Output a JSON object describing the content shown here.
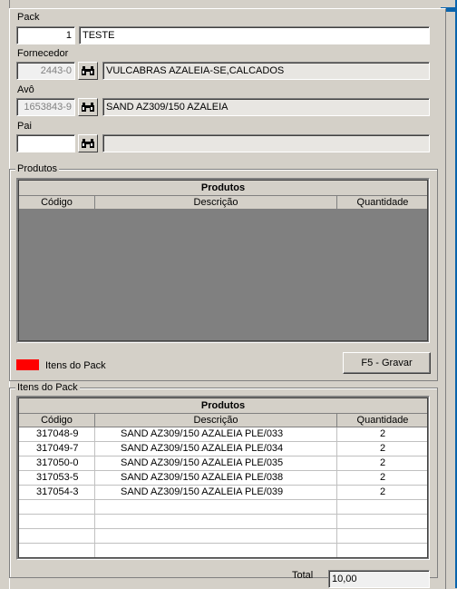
{
  "pack": {
    "label": "Pack",
    "number": "1",
    "name": "TESTE"
  },
  "fornecedor": {
    "label": "Fornecedor",
    "code": "2443-0",
    "name": "VULCABRAS AZALEIA-SE,CALCADOS"
  },
  "avo": {
    "label": "Avô",
    "code": "1653843-9",
    "name": "SAND AZ309/150 AZALEIA"
  },
  "pai": {
    "label": "Pai",
    "code": "",
    "name": ""
  },
  "produtos": {
    "group_title": "Produtos",
    "grid_title": "Produtos",
    "columns": [
      "Código",
      "Descrição",
      "Quantidade"
    ],
    "rows": []
  },
  "legend": {
    "label": "Itens do Pack",
    "color": "#ff0000"
  },
  "save_button": "F5 - Gravar",
  "itens_pack": {
    "group_title": "Itens do Pack",
    "grid_title": "Produtos",
    "columns": [
      "Código",
      "Descrição",
      "Quantidade"
    ],
    "rows": [
      {
        "codigo": "317048-9",
        "descricao": "SAND AZ309/150 AZALEIA PLE/033",
        "quantidade": "2"
      },
      {
        "codigo": "317049-7",
        "descricao": "SAND AZ309/150 AZALEIA PLE/034",
        "quantidade": "2"
      },
      {
        "codigo": "317050-0",
        "descricao": "SAND AZ309/150 AZALEIA PLE/035",
        "quantidade": "2"
      },
      {
        "codigo": "317053-5",
        "descricao": "SAND AZ309/150 AZALEIA PLE/038",
        "quantidade": "2"
      },
      {
        "codigo": "317054-3",
        "descricao": "SAND AZ309/150 AZALEIA PLE/039",
        "quantidade": "2"
      }
    ]
  },
  "total": {
    "label": "Total",
    "value": "10,00"
  }
}
